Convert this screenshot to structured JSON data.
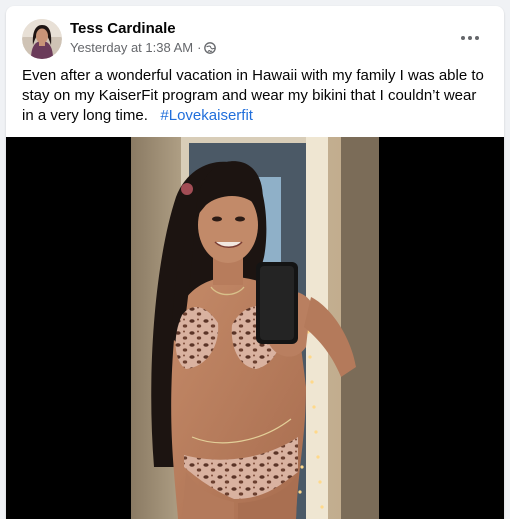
{
  "post": {
    "author": "Tess Cardinale",
    "timestamp": "Yesterday at 1:38 AM",
    "separator": "·",
    "audience_icon": "globe-icon",
    "more_icon": "more-options-icon",
    "caption_text": "Even after a wonderful vacation in Hawaii with my family I was able to stay on my KaiserFit program and wear my bikini that I couldn’t wear in a very long time.",
    "hashtag": "#Lovekaiserfit",
    "photo_alt_subject": "mirror-selfie-photo"
  },
  "colors": {
    "page_bg": "#f0f2f5",
    "card_bg": "#ffffff",
    "text_primary": "#050505",
    "text_secondary": "#65676b",
    "link": "#216fdb"
  }
}
